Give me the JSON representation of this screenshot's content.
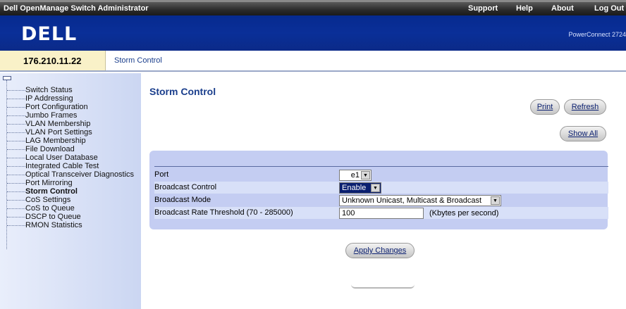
{
  "header": {
    "app_title": "Dell OpenManage Switch Administrator",
    "nav": [
      {
        "label": "Support"
      },
      {
        "label": "Help"
      },
      {
        "label": "About"
      },
      {
        "label": "Log Out"
      }
    ]
  },
  "banner": {
    "logo_text": "DELL",
    "product": "PowerConnect 2724"
  },
  "addressbar": {
    "ip": "176.210.11.22",
    "breadcrumb": "Storm Control"
  },
  "sidebar": {
    "items": [
      {
        "label": "Switch Status"
      },
      {
        "label": "IP Addressing"
      },
      {
        "label": "Port Configuration"
      },
      {
        "label": "Jumbo Frames"
      },
      {
        "label": "VLAN Membership"
      },
      {
        "label": "VLAN Port Settings"
      },
      {
        "label": "LAG Membership"
      },
      {
        "label": "File Download"
      },
      {
        "label": "Local User Database"
      },
      {
        "label": "Integrated Cable Test"
      },
      {
        "label": "Optical Transceiver Diagnostics"
      },
      {
        "label": "Port Mirroring"
      },
      {
        "label": "Storm Control",
        "active": true
      },
      {
        "label": "CoS Settings"
      },
      {
        "label": "CoS to Queue"
      },
      {
        "label": "DSCP to Queue"
      },
      {
        "label": "RMON Statistics"
      }
    ]
  },
  "main": {
    "title": "Storm Control",
    "buttons": {
      "print": "Print",
      "refresh": "Refresh",
      "show_all": "Show All",
      "apply": "Apply Changes"
    },
    "form": {
      "port": {
        "label": "Port",
        "value": "e1"
      },
      "broadcast_control": {
        "label": "Broadcast Control",
        "value": "Enable"
      },
      "broadcast_mode": {
        "label": "Broadcast Mode",
        "value": "Unknown Unicast, Multicast & Broadcast"
      },
      "rate_threshold": {
        "label": "Broadcast Rate Threshold (70 - 285000)",
        "value": "100",
        "unit": "(Kbytes per second)"
      }
    }
  },
  "colors": {
    "banner": "#0a2f98",
    "accent": "#1a3e8c",
    "panel": "#c4cdf2",
    "ip_background": "#f9f1c8"
  }
}
